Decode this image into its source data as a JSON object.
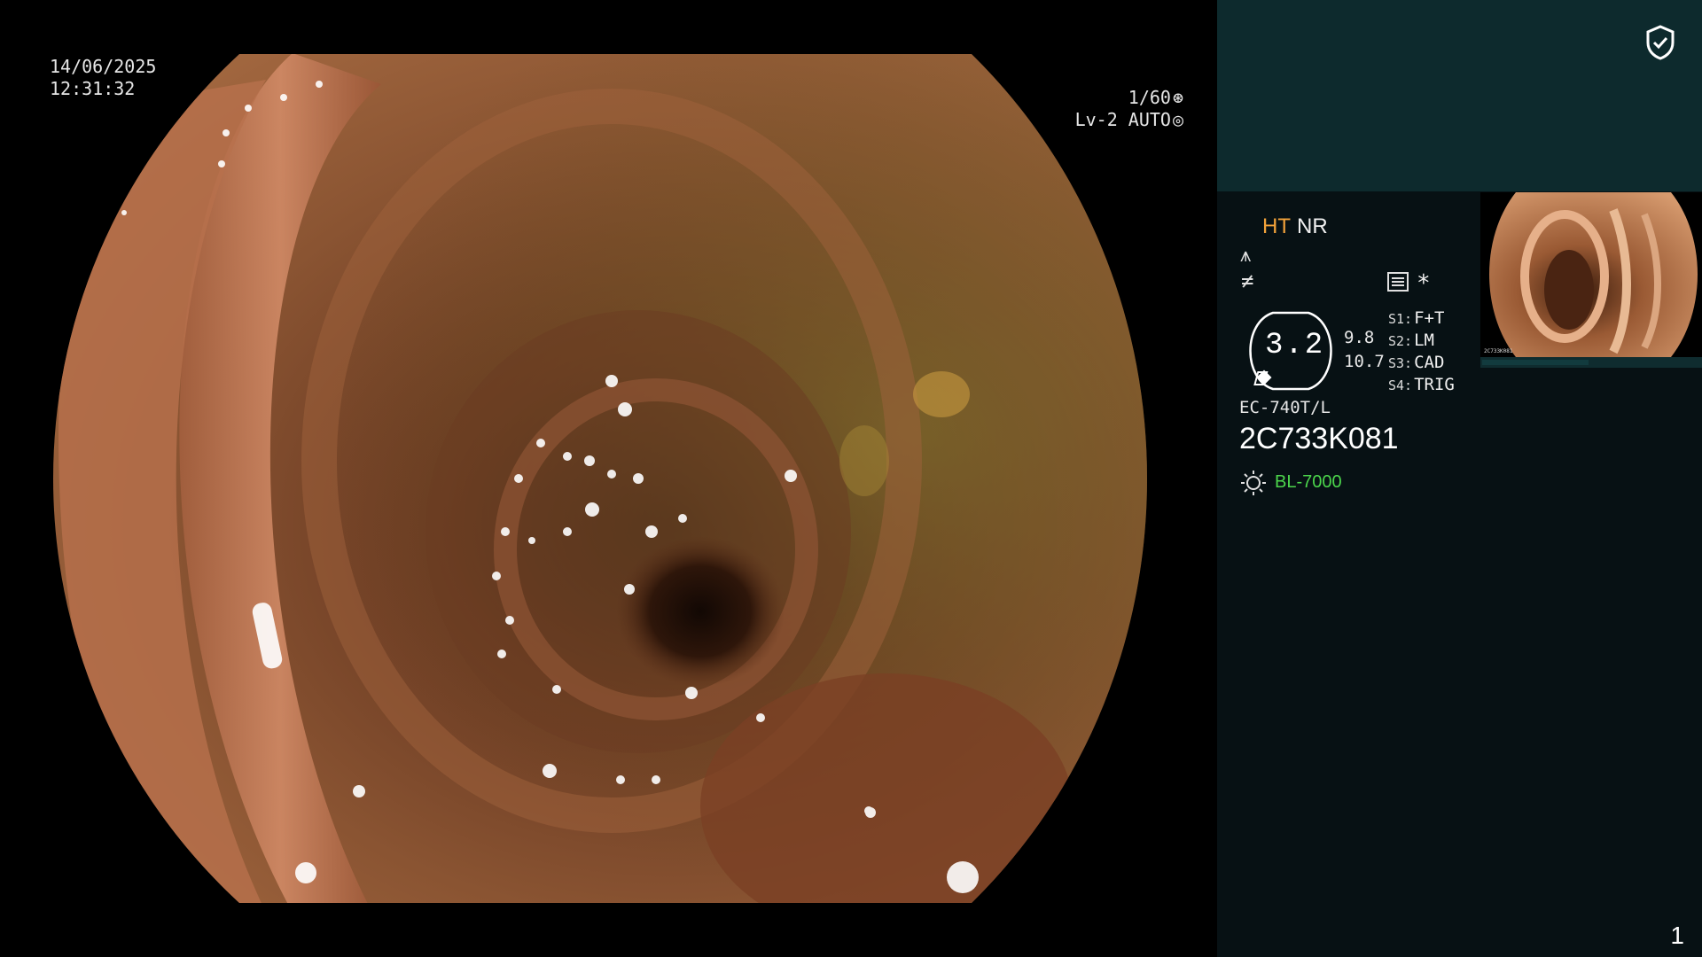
{
  "overlay": {
    "date": "14/06/2025",
    "time": "12:31:32",
    "shutter": "1/60",
    "level": "Lv-2 AUTO"
  },
  "panel": {
    "mode_ht": "HT",
    "mode_nr": "NR",
    "gauge_value": "3.2",
    "side_value_1": "9.8",
    "side_value_2": "10.7",
    "switches": [
      {
        "key": "S1:",
        "value": "F+T"
      },
      {
        "key": "S2:",
        "value": "LM"
      },
      {
        "key": "S3:",
        "value": "CAD"
      },
      {
        "key": "S4:",
        "value": "TRIG"
      }
    ],
    "scope_model": "EC-740T/L",
    "scope_serial": "2C733K081",
    "light_source": "BL-7000",
    "asterisk": "*",
    "page_number": "1"
  },
  "thumbnail": {
    "caption": "2C733K081"
  },
  "colors": {
    "panel_bg": "#071114",
    "panel_top_bg": "#0d2a2d",
    "ht_color": "#f2a23a",
    "light_color": "#4cd64c"
  },
  "icons": [
    "shield-check-icon",
    "aperture-icon",
    "iris-icon",
    "cable-icon",
    "slash-icon",
    "settings-list-icon",
    "gauge-icon",
    "light-bulb-icon"
  ]
}
